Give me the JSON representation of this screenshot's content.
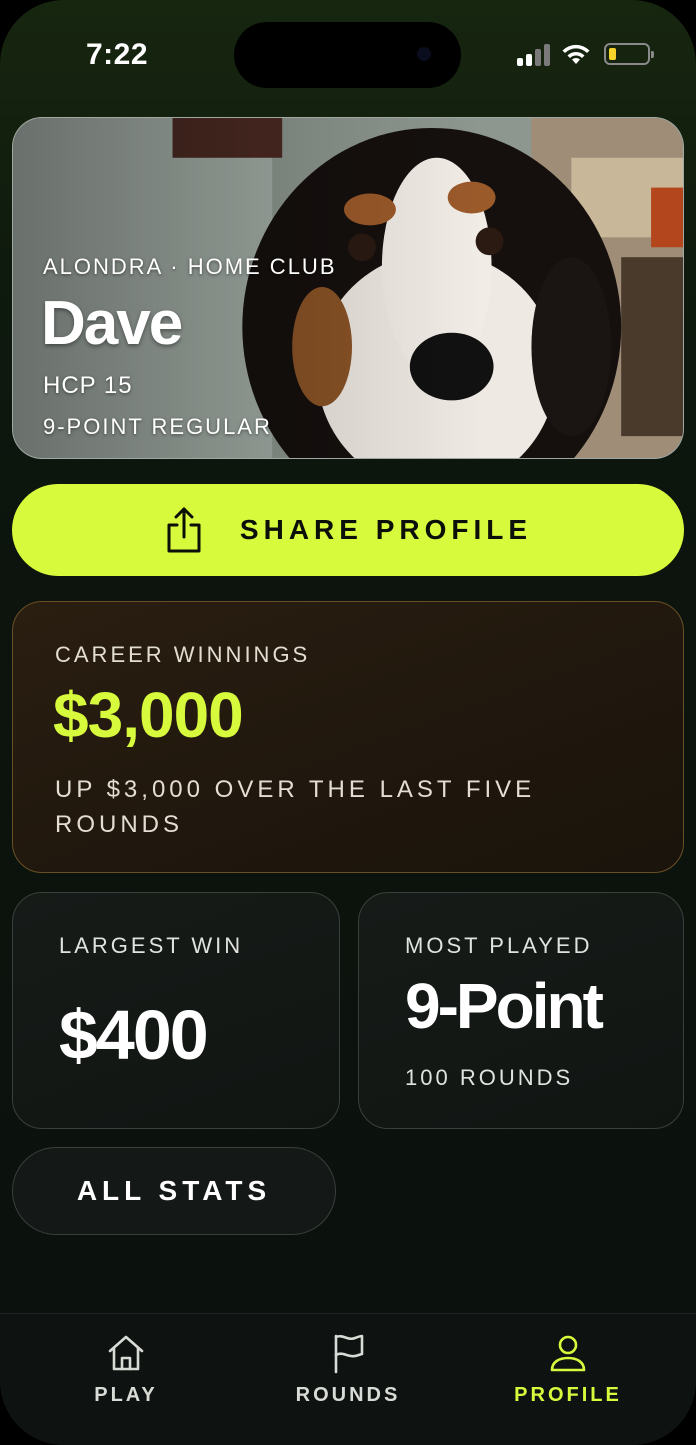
{
  "status_bar": {
    "time": "7:22"
  },
  "profile": {
    "club_line": "ALONDRA · HOME CLUB",
    "name": "Dave",
    "handicap": "HCP 15",
    "player_type": "9-POINT REGULAR"
  },
  "share_button": {
    "label": "SHARE PROFILE",
    "icon": "share-icon"
  },
  "career": {
    "label": "CAREER WINNINGS",
    "value": "$3,000",
    "note": "UP $3,000 OVER THE LAST FIVE ROUNDS"
  },
  "largest_win": {
    "label": "LARGEST WIN",
    "value": "$400"
  },
  "most_played": {
    "label": "MOST PLAYED",
    "value": "9-Point",
    "sub": "100 ROUNDS"
  },
  "all_stats_button": {
    "label": "ALL STATS"
  },
  "tabs": [
    {
      "label": "PLAY",
      "icon": "home-icon",
      "active": false
    },
    {
      "label": "ROUNDS",
      "icon": "flag-icon",
      "active": false
    },
    {
      "label": "PROFILE",
      "icon": "person-icon",
      "active": true
    }
  ],
  "colors": {
    "accent": "#d8fa3c",
    "background": "#0c140d",
    "winnings_border": "#6b4f26"
  }
}
